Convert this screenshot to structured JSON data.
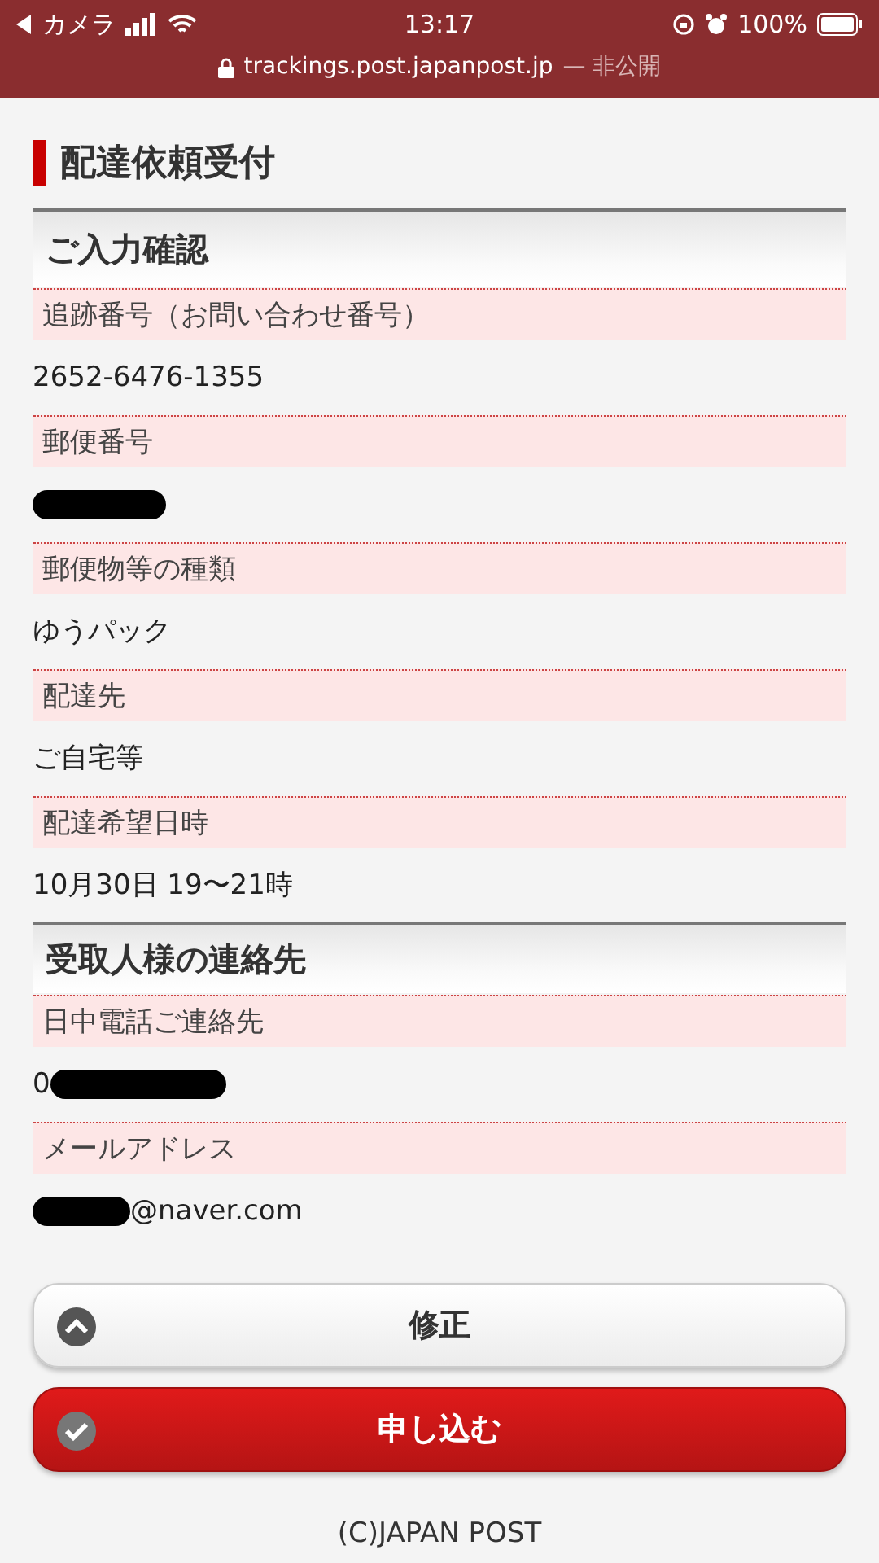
{
  "status_bar": {
    "back_app": "カメラ",
    "time": "13:17",
    "battery": "100%",
    "url": "trackings.post.japanpost.jp",
    "privacy": "— 非公開"
  },
  "page_title": "配達依頼受付",
  "sections": [
    {
      "heading": "ご入力確認",
      "fields": [
        {
          "label": "追跡番号（お問い合わせ番号）",
          "value": "2652-6476-1355"
        },
        {
          "label": "郵便番号",
          "redacted_before": true
        },
        {
          "label": "郵便物等の種類",
          "value": "ゆうパック"
        },
        {
          "label": "配達先",
          "value": "ご自宅等"
        },
        {
          "label": "配達希望日時",
          "value": "10月30日 19〜21時"
        }
      ]
    },
    {
      "heading": "受取人様の連絡先",
      "fields": [
        {
          "label": "日中電話ご連絡先",
          "value": "0",
          "redacted_after": true
        },
        {
          "label": "メールアドレス",
          "value": "@naver.com",
          "redacted_before": true
        }
      ]
    }
  ],
  "buttons": [
    {
      "label": "修正",
      "kind": "secondary"
    },
    {
      "label": "申し込む",
      "kind": "primary"
    }
  ],
  "footer": "(C)JAPAN POST"
}
